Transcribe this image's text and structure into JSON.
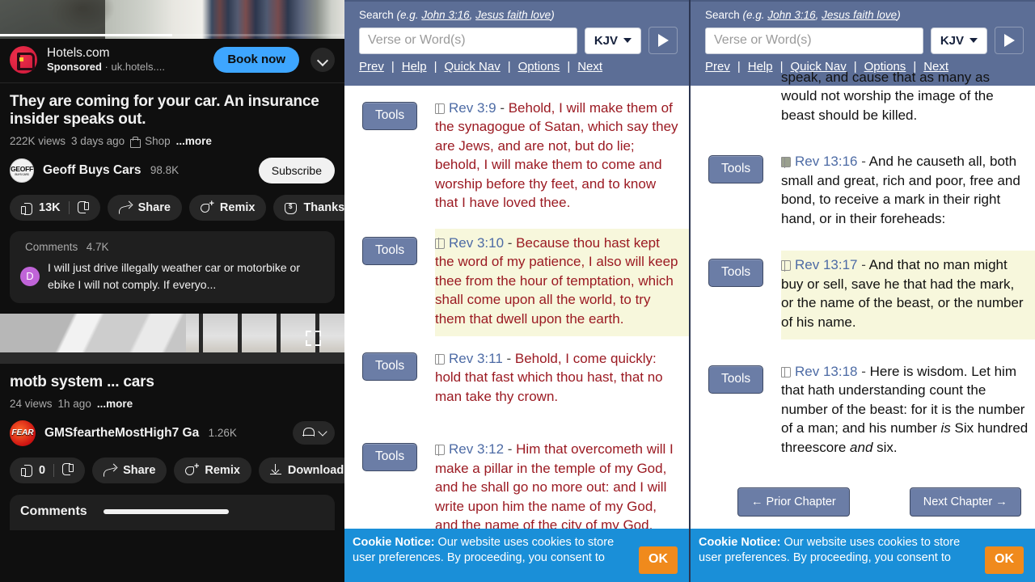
{
  "youtube": {
    "ad": {
      "advertiser": "Hotels.com",
      "sponsored_label": "Sponsored",
      "separator": "·",
      "domain": "uk.hotels....",
      "cta_label": "Book now",
      "logo_icon": "hotels-logo-icon",
      "expand_icon": "chevron-down-icon"
    },
    "video1": {
      "title": "They are coming for your car. An insurance insider speaks out.",
      "views": "222K views",
      "age": "3 days ago",
      "shop_label": "Shop",
      "shop_icon": "shopping-bag-icon",
      "more_label": "...more",
      "channel_name": "Geoff Buys Cars",
      "channel_avatar_text": "GEOFF",
      "channel_avatar_sub": "BUYS CARS",
      "subscriber_count": "98.8K",
      "subscribe_label": "Subscribe",
      "progress_percent": 50,
      "actions": [
        {
          "label": "13K",
          "icon": "thumbs-up-icon"
        },
        {
          "label": "",
          "icon": "thumbs-down-icon"
        },
        {
          "label": "Share",
          "icon": "share-arrow-icon"
        },
        {
          "label": "Remix",
          "icon": "remix-icon"
        },
        {
          "label": "Thanks",
          "icon": "thanks-heart-dollar-icon"
        }
      ],
      "comments": {
        "header": "Comments",
        "count": "4.7K",
        "top_comment_avatar": "D",
        "top_comment": "I will just drive illegally weather car or motorbike or ebike I will not comply. If everyo..."
      }
    },
    "video2": {
      "title": "motb system ... cars",
      "views": "24 views",
      "age": "1h ago",
      "more_label": "...more",
      "channel_name": "GMSfeartheMostHigh7 Ga",
      "channel_avatar_text": "FEAR",
      "subscriber_count": "1.26K",
      "bell_icon": "notification-bell-icon",
      "bell_chevron_icon": "chevron-down-icon",
      "fullscreen_icon": "fullscreen-icon",
      "actions": [
        {
          "label": "0",
          "icon": "thumbs-up-icon"
        },
        {
          "label": "",
          "icon": "thumbs-down-icon"
        },
        {
          "label": "Share",
          "icon": "share-arrow-icon"
        },
        {
          "label": "Remix",
          "icon": "remix-icon"
        },
        {
          "label": "Download",
          "icon": "download-icon"
        }
      ],
      "comments_label": "Comments"
    }
  },
  "bible_panels": {
    "header": {
      "search_label_prefix": "Search",
      "search_example_open": "(e.g. ",
      "example_1": "John 3:16",
      "example_comma": ", ",
      "example_2": "Jesus faith love",
      "search_example_close": ")",
      "input_placeholder": "Verse or Word(s)",
      "input_value": "",
      "version": "KJV",
      "version_caret_icon": "caret-down-icon",
      "go_icon": "play-arrow-icon",
      "nav_links": [
        "Prev",
        "Help",
        "Quick Nav",
        "Options",
        "Next"
      ],
      "nav_separator": "|"
    },
    "tools_label": "Tools",
    "middle": {
      "verses": [
        {
          "ref": "Rev 3:9",
          "dash": " - ",
          "text": "Behold, I will make them of the synagogue of Satan, which say they are Jews, and are not, but do lie; behold, I will make them to come and worship before thy feet, and to know that I have loved thee.",
          "highlighted": false,
          "icon": "book-outline-icon"
        },
        {
          "ref": "Rev 3:10",
          "dash": " - ",
          "text": "Because thou hast kept the word of my patience, I also will keep thee from the hour of temptation, which shall come upon all the world, to try them that dwell upon the earth.",
          "highlighted": true,
          "icon": "book-outline-icon"
        },
        {
          "ref": "Rev 3:11",
          "dash": " - ",
          "text": "Behold, I come quickly: hold that fast which thou hast, that no man take thy crown.",
          "highlighted": false,
          "icon": "book-outline-icon"
        },
        {
          "ref": "Rev 3:12",
          "dash": " - ",
          "text": "Him that overcometh will I make a pillar in the temple of my God, and he shall go no more out: and I will write upon him the name of my God, and the name of the city of my God,",
          "highlighted": false,
          "icon": "book-outline-icon"
        }
      ]
    },
    "right": {
      "partial_verse_text": "speak, and cause that as many as would not worship the image of the beast should be killed.",
      "verses": [
        {
          "ref": "Rev 13:16",
          "dash": " - ",
          "text": "And he causeth all, both small and great, rich and poor, free and bond, to receive a mark in their right hand, or in their foreheads:",
          "highlighted": false,
          "icon": "book-filled-icon"
        },
        {
          "ref": "Rev 13:17",
          "dash": " - ",
          "text": "And that no man might buy or sell, save he that had the mark, or the name of the beast, or the number of his name.",
          "highlighted": true,
          "icon": "book-outline-icon"
        },
        {
          "ref": "Rev 13:18",
          "dash": " - ",
          "text": "Here is wisdom. Let him that hath understanding count the number of the beast: for it is the number of a man; and his number is Six hundred threescore and six.",
          "highlighted": false,
          "icon": "book-outline-icon"
        }
      ],
      "prior_chapter_label": "← Prior Chapter",
      "next_chapter_label": "Next Chapter →"
    },
    "cookie": {
      "bold_prefix": "Cookie Notice:",
      "body": " Our website uses cookies to store user preferences. By proceeding, you consent to",
      "ok_label": "OK"
    }
  },
  "colors": {
    "yt_background": "#0f0f0f",
    "yt_chip": "#272727",
    "yt_accent_blue": "#3ea6ff",
    "bible_header": "#5c6e96",
    "bible_tools_btn": "#6b7da6",
    "verse_ref_blue": "#4d6ba5",
    "verse_red": "#9b1a22",
    "verse_black": "#111111",
    "highlight_yellow": "#f7f7dc",
    "cookie_blue": "#1a8fd8",
    "cookie_ok_orange": "#f08a1c"
  }
}
